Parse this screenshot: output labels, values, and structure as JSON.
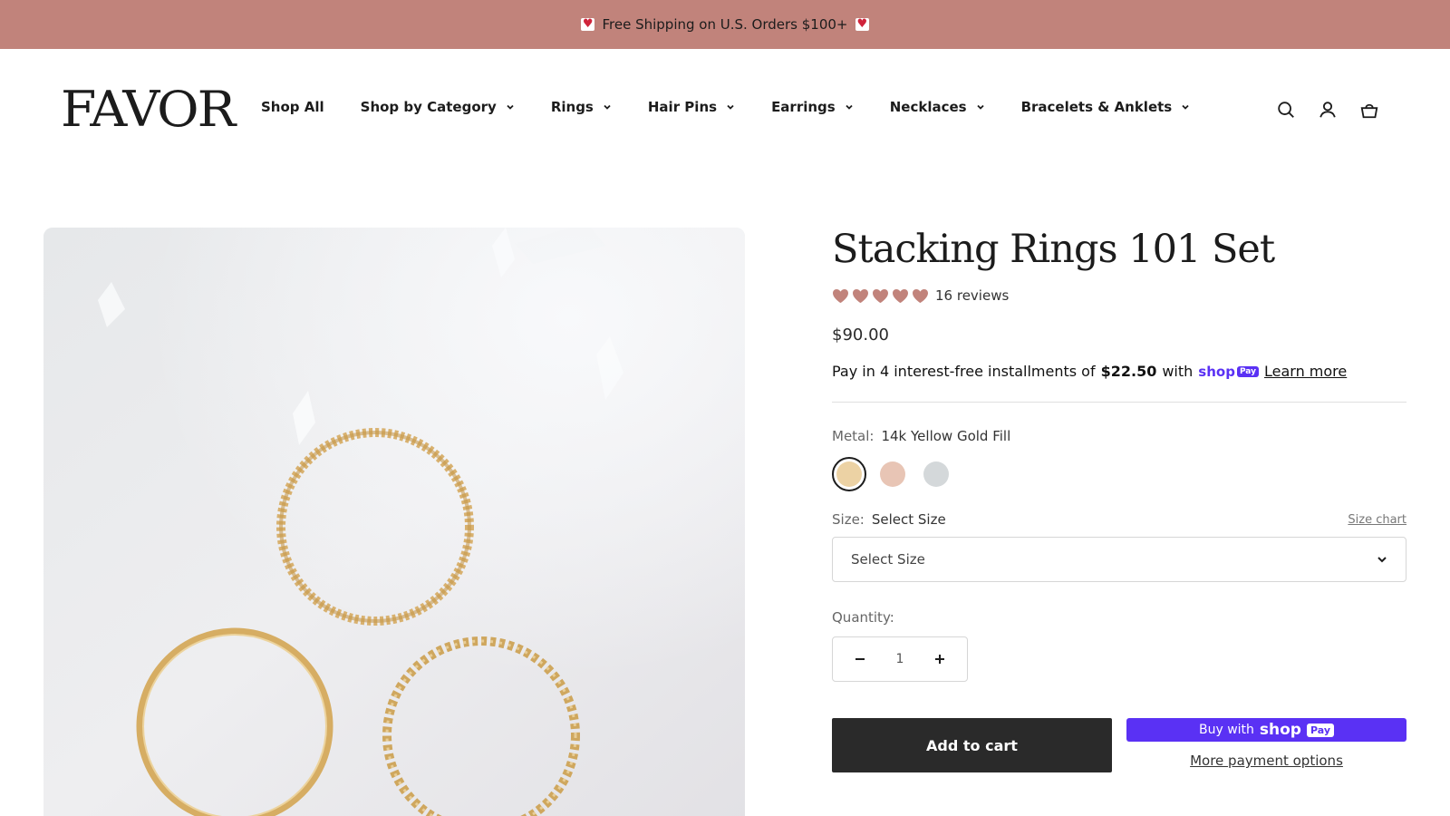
{
  "announcement": {
    "text": "Free Shipping on U.S. Orders $100+"
  },
  "header": {
    "logo": "FAVOR",
    "nav": [
      {
        "label": "Shop All",
        "dropdown": false
      },
      {
        "label": "Shop by Category",
        "dropdown": true
      },
      {
        "label": "Rings",
        "dropdown": true
      },
      {
        "label": "Hair Pins",
        "dropdown": true
      },
      {
        "label": "Earrings",
        "dropdown": true
      },
      {
        "label": "Necklaces",
        "dropdown": true
      },
      {
        "label": "Bracelets & Anklets",
        "dropdown": true
      }
    ],
    "icons": [
      "search-icon",
      "account-icon",
      "cart-icon"
    ]
  },
  "product": {
    "title": "Stacking Rings 101 Set",
    "rating": 5,
    "reviews": "16 reviews",
    "price": "$90.00",
    "installments": {
      "prefix": "Pay in 4 interest-free installments of",
      "amount": "$22.50",
      "suffix": "with",
      "brand": "shop",
      "brand_badge": "Pay",
      "learn_more": "Learn more"
    },
    "metal": {
      "label": "Metal:",
      "value": "14k Yellow Gold Fill",
      "swatches": [
        {
          "name": "yellow-gold",
          "color": "#ecd2a4",
          "selected": true
        },
        {
          "name": "rose-gold",
          "color": "#e8c5b5",
          "selected": false
        },
        {
          "name": "silver",
          "color": "#d4d8da",
          "selected": false
        }
      ]
    },
    "size": {
      "label": "Size:",
      "value": "Select Size",
      "chart_link": "Size chart",
      "select_value": "Select Size"
    },
    "quantity": {
      "label": "Quantity:",
      "value": "1"
    },
    "add_to_cart": "Add to cart",
    "buy_with": {
      "prefix": "Buy with",
      "brand": "shop",
      "badge": "Pay"
    },
    "more_payment": "More payment options"
  },
  "colors": {
    "announcement_bg": "#c1837b",
    "heart": "#c1837b",
    "shop_pay": "#5a31f4",
    "primary_button": "#2a2a2a"
  }
}
